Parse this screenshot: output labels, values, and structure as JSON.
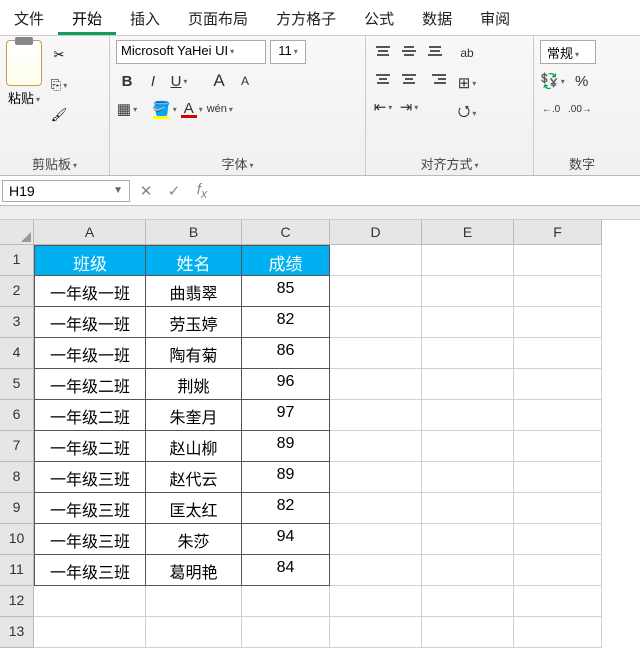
{
  "menu": {
    "items": [
      "文件",
      "开始",
      "插入",
      "页面布局",
      "方方格子",
      "公式",
      "数据",
      "审阅"
    ],
    "activeIndex": 1
  },
  "ribbon": {
    "clipboard": {
      "paste": "粘贴",
      "label": "剪贴板"
    },
    "font": {
      "name": "Microsoft YaHei UI",
      "size": "11",
      "bold": "B",
      "italic": "I",
      "underline": "U",
      "grow": "A",
      "shrink": "A",
      "fontcolor": "A",
      "wen": "wén",
      "label": "字体"
    },
    "align": {
      "wrap": "ab",
      "label": "对齐方式"
    },
    "number": {
      "format": "常规",
      "inc": "0.0",
      "dec": ".00",
      "arrow1": "←.0",
      "arrow2": ".00→",
      "label": "数字"
    }
  },
  "namebox": "H19",
  "formula": "",
  "columns": [
    "A",
    "B",
    "C",
    "D",
    "E",
    "F"
  ],
  "rowNumbers": [
    "1",
    "2",
    "3",
    "4",
    "5",
    "6",
    "7",
    "8",
    "9",
    "10",
    "11",
    "12",
    "13"
  ],
  "table": {
    "headers": [
      "班级",
      "姓名",
      "成绩"
    ],
    "rows": [
      [
        "一年级一班",
        "曲翡翠",
        "85"
      ],
      [
        "一年级一班",
        "劳玉婷",
        "82"
      ],
      [
        "一年级一班",
        "陶有菊",
        "86"
      ],
      [
        "一年级二班",
        "荆姚",
        "96"
      ],
      [
        "一年级二班",
        "朱奎月",
        "97"
      ],
      [
        "一年级二班",
        "赵山柳",
        "89"
      ],
      [
        "一年级三班",
        "赵代云",
        "89"
      ],
      [
        "一年级三班",
        "匡太红",
        "82"
      ],
      [
        "一年级三班",
        "朱莎",
        "94"
      ],
      [
        "一年级三班",
        "葛明艳",
        "84"
      ]
    ]
  },
  "chart_data": {
    "type": "table",
    "columns": [
      "班级",
      "姓名",
      "成绩"
    ],
    "rows": [
      [
        "一年级一班",
        "曲翡翠",
        85
      ],
      [
        "一年级一班",
        "劳玉婷",
        82
      ],
      [
        "一年级一班",
        "陶有菊",
        86
      ],
      [
        "一年级二班",
        "荆姚",
        96
      ],
      [
        "一年级二班",
        "朱奎月",
        97
      ],
      [
        "一年级二班",
        "赵山柳",
        89
      ],
      [
        "一年级三班",
        "赵代云",
        89
      ],
      [
        "一年级三班",
        "匡太红",
        82
      ],
      [
        "一年级三班",
        "朱莎",
        94
      ],
      [
        "一年级三班",
        "葛明艳",
        84
      ]
    ]
  }
}
